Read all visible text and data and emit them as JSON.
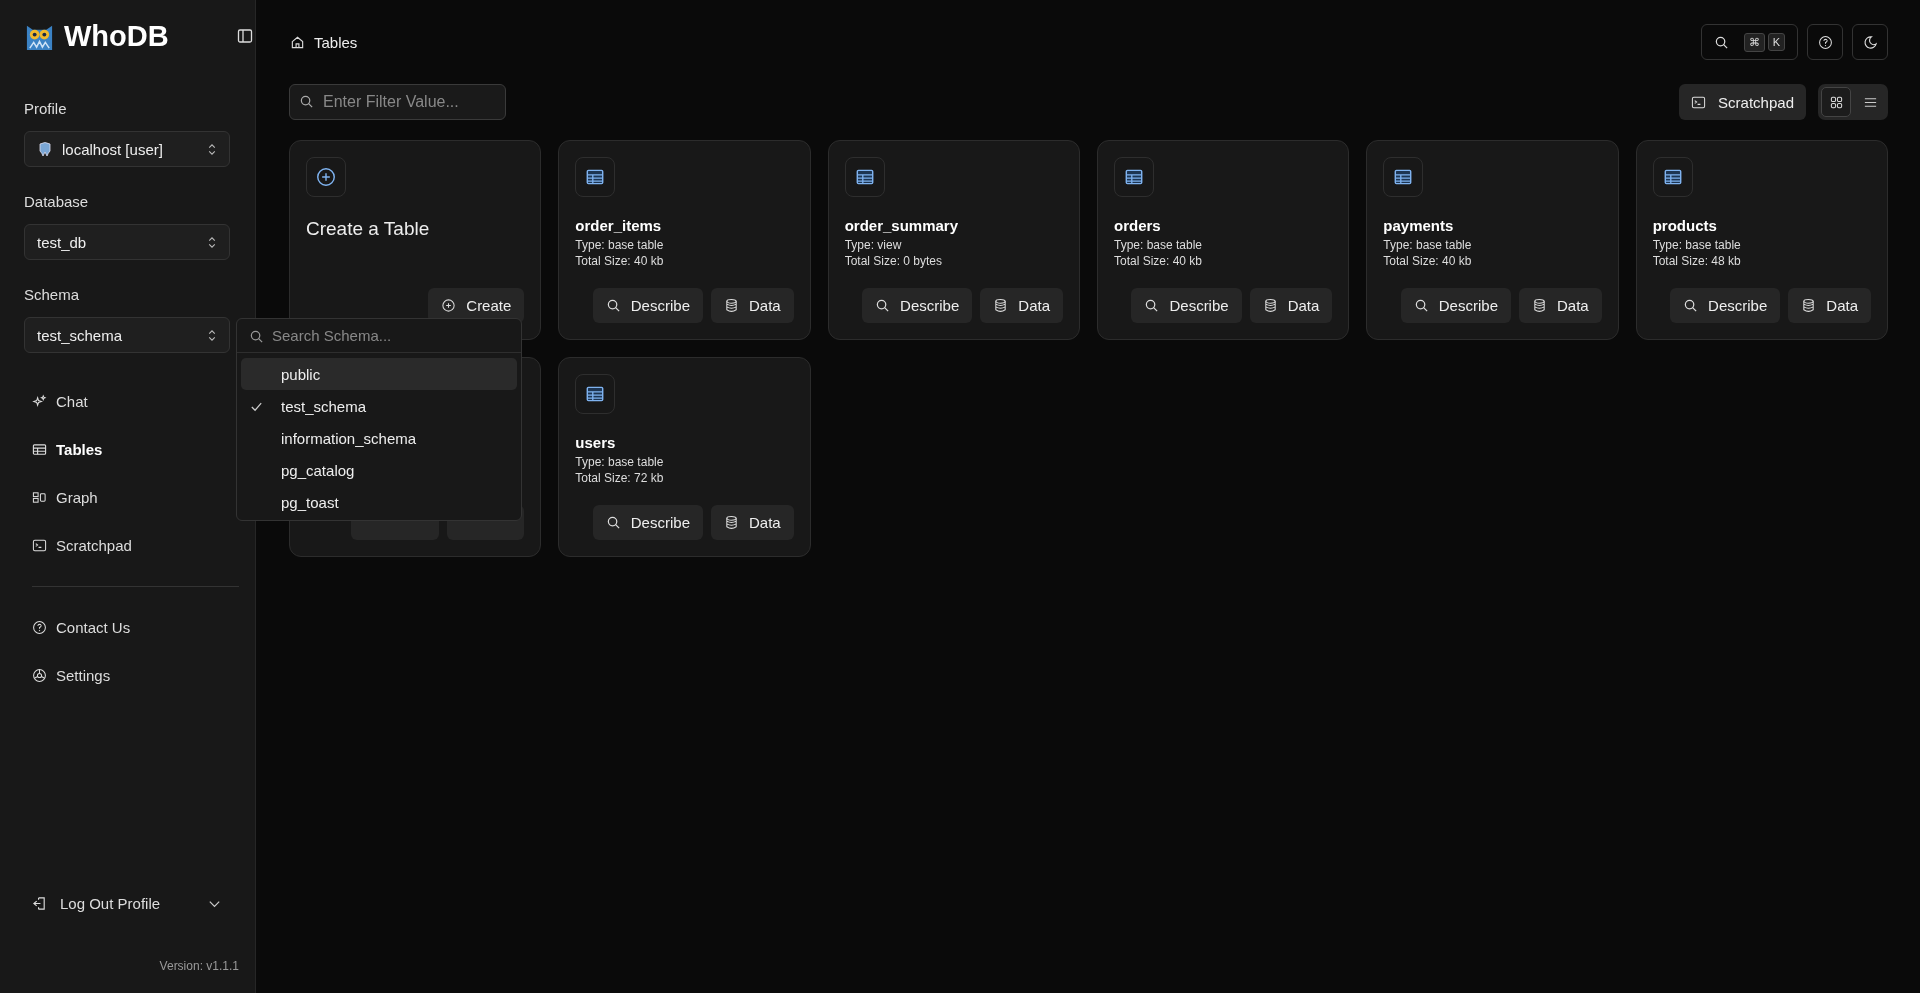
{
  "app": {
    "name": "WhoDB",
    "version": "Version: v1.1.1"
  },
  "sidebar": {
    "selectors": [
      {
        "label": "Profile",
        "value": "localhost [user]",
        "kind": "profile"
      },
      {
        "label": "Database",
        "value": "test_db",
        "kind": "plain"
      },
      {
        "label": "Schema",
        "value": "test_schema",
        "kind": "plain"
      }
    ],
    "nav": [
      {
        "label": "Chat",
        "kind": "chat",
        "selected": false
      },
      {
        "label": "Tables",
        "kind": "tables",
        "selected": true
      },
      {
        "label": "Graph",
        "kind": "graph",
        "selected": false
      },
      {
        "label": "Scratchpad",
        "kind": "scratchpad",
        "selected": false
      }
    ],
    "secondary_nav": [
      {
        "label": "Contact Us",
        "kind": "help",
        "selected": false
      },
      {
        "label": "Settings",
        "kind": "settings",
        "selected": false
      }
    ],
    "logout": "Log Out Profile"
  },
  "breadcrumb": "Tables",
  "header": {
    "shortcut_keys": [
      "⌘",
      "K"
    ]
  },
  "filter": {
    "placeholder": "Enter Filter Value..."
  },
  "scratchpad_button": "Scratchpad",
  "view_modes": [
    {
      "kind": "grid",
      "selected": true
    },
    {
      "kind": "list",
      "selected": false
    }
  ],
  "create_card": {
    "title": "Create a Table",
    "button": "Create"
  },
  "tables": [
    {
      "name": "order_items",
      "type": "Type: base table",
      "size": "Total Size: 40 kb",
      "describe": "Describe",
      "data": "Data"
    },
    {
      "name": "order_summary",
      "type": "Type: view",
      "size": "Total Size: 0 bytes",
      "describe": "Describe",
      "data": "Data"
    },
    {
      "name": "orders",
      "type": "Type: base table",
      "size": "Total Size: 40 kb",
      "describe": "Describe",
      "data": "Data"
    },
    {
      "name": "payments",
      "type": "Type: base table",
      "size": "Total Size: 40 kb",
      "describe": "Describe",
      "data": "Data"
    },
    {
      "name": "products",
      "type": "Type: base table",
      "size": "Total Size: 48 kb",
      "describe": "Describe",
      "data": "Data"
    },
    {
      "kind": "covered"
    },
    {
      "name": "users",
      "type": "Type: base table",
      "size": "Total Size: 72 kb",
      "describe": "Describe",
      "data": "Data"
    }
  ],
  "schema_dropdown": {
    "placeholder": "Search Schema...",
    "options": [
      {
        "label": "public",
        "selected": false,
        "highlighted": true
      },
      {
        "label": "test_schema",
        "selected": true,
        "highlighted": false
      },
      {
        "label": "information_schema",
        "selected": false,
        "highlighted": false
      },
      {
        "label": "pg_catalog",
        "selected": false,
        "highlighted": false
      },
      {
        "label": "pg_toast",
        "selected": false,
        "highlighted": false
      }
    ]
  }
}
